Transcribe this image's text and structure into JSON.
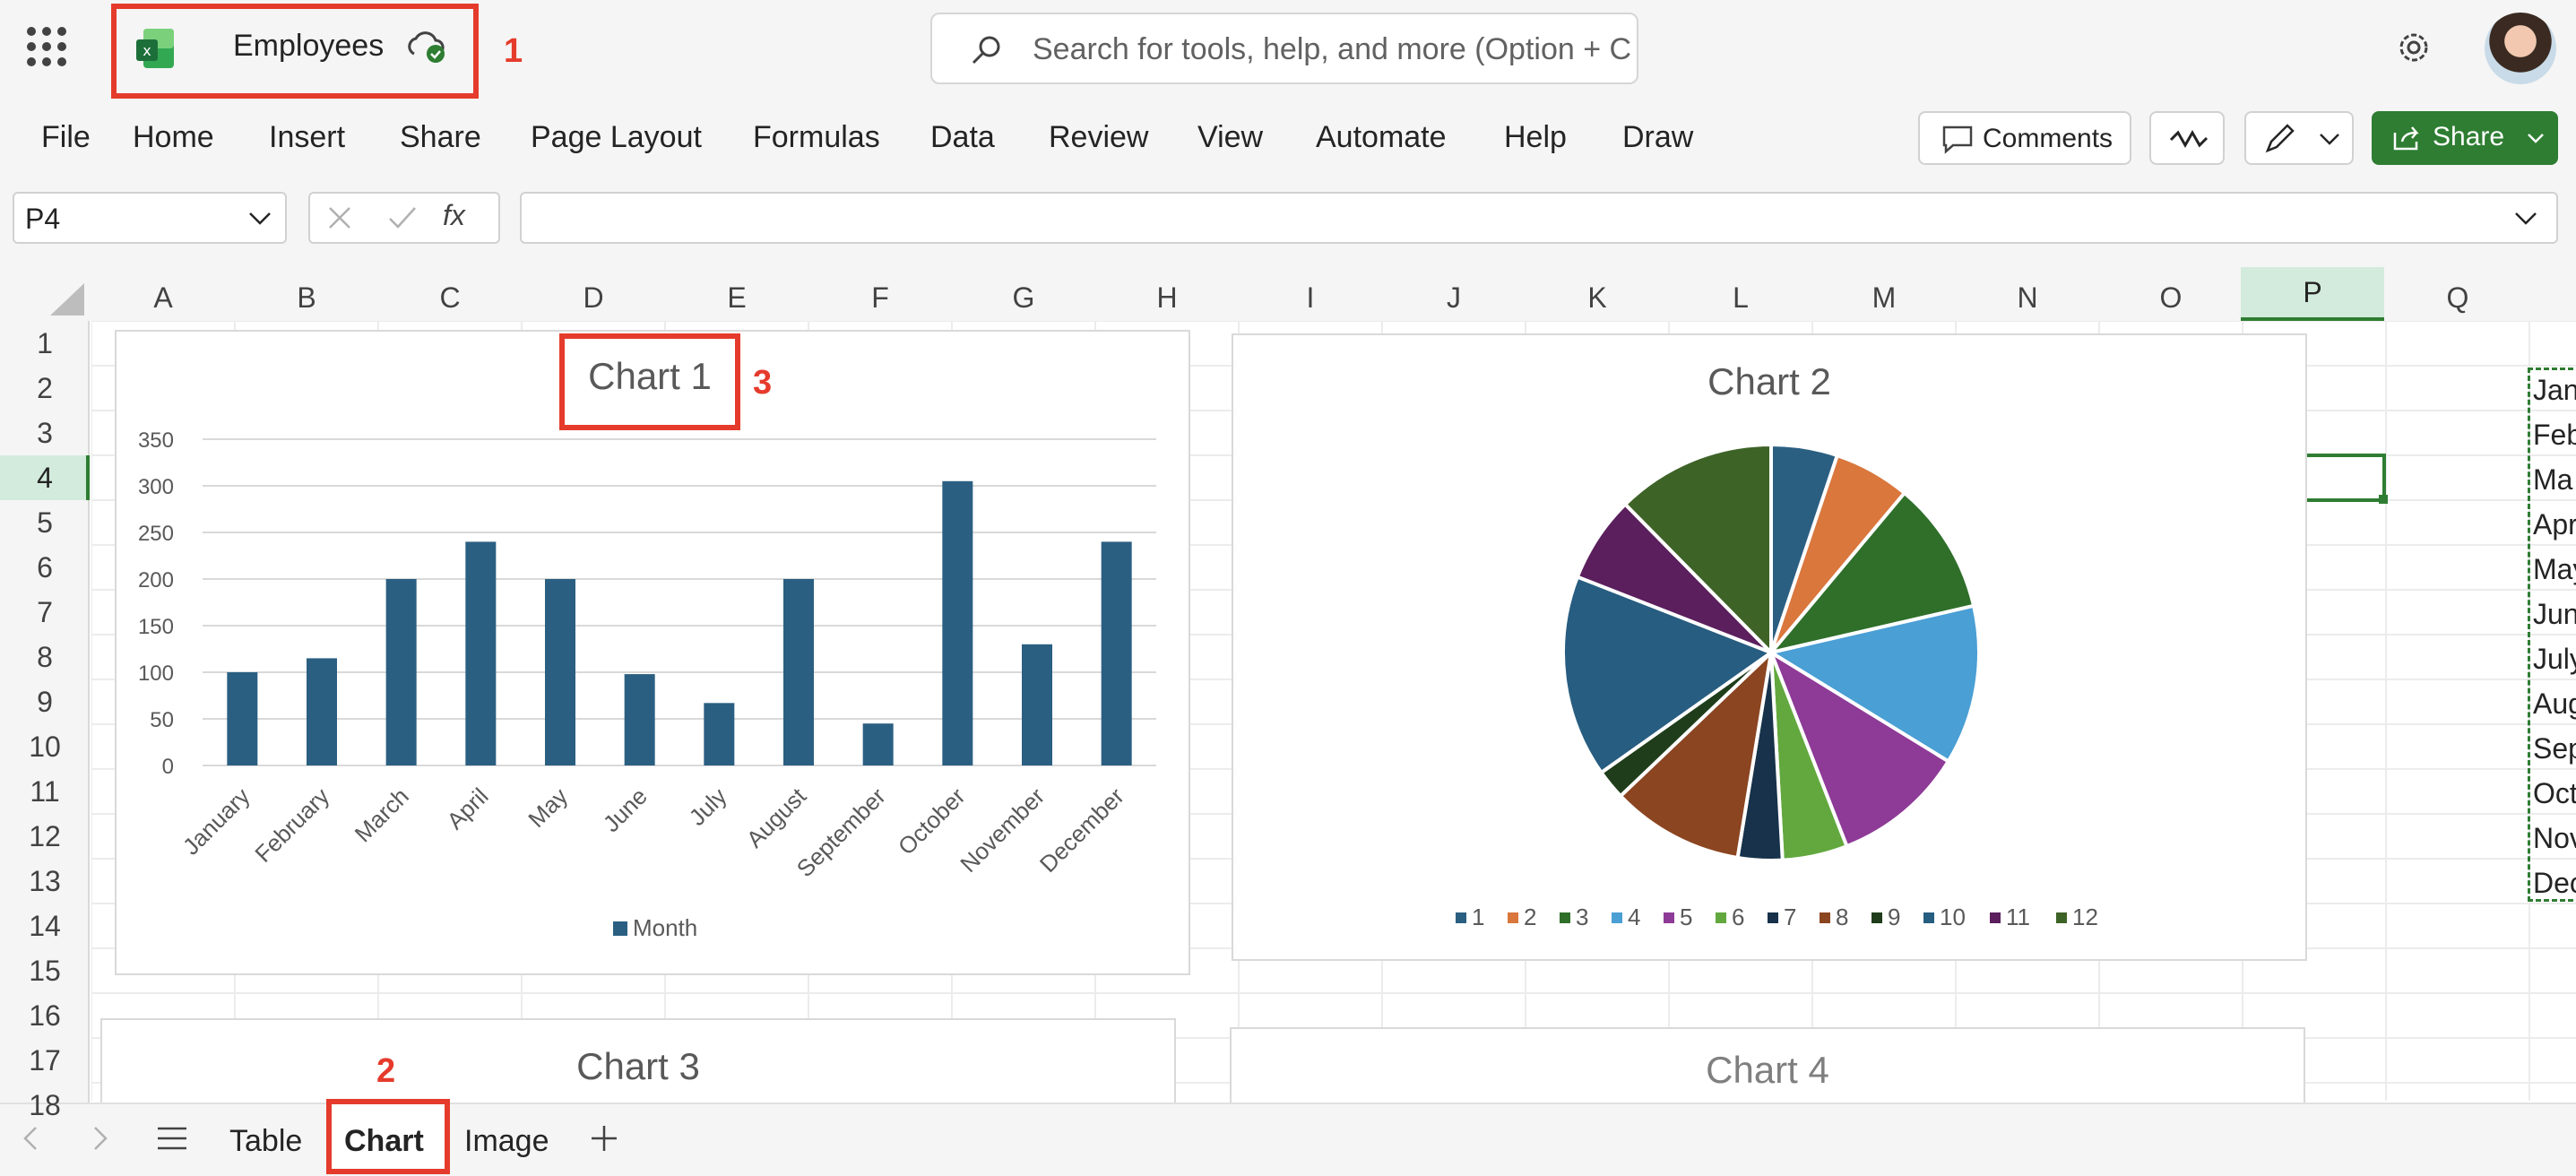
{
  "app": {
    "document_title": "Employees"
  },
  "annotations": {
    "one": "1",
    "two": "2",
    "three": "3"
  },
  "search": {
    "placeholder": "Search for tools, help, and more (Option + C"
  },
  "menu": [
    "File",
    "Home",
    "Insert",
    "Share",
    "Page Layout",
    "Formulas",
    "Data",
    "Review",
    "View",
    "Automate",
    "Help",
    "Draw"
  ],
  "toolbar": {
    "comments_label": "Comments",
    "share_label": "Share"
  },
  "formula_bar": {
    "name_box": "P4",
    "fx_label": "fx",
    "formula": ""
  },
  "columns": [
    "A",
    "B",
    "C",
    "D",
    "E",
    "F",
    "G",
    "H",
    "I",
    "J",
    "K",
    "L",
    "M",
    "N",
    "O",
    "P",
    "Q"
  ],
  "rows": [
    "1",
    "2",
    "3",
    "4",
    "5",
    "6",
    "7",
    "8",
    "9",
    "10",
    "11",
    "12",
    "13",
    "14",
    "15",
    "16",
    "17",
    "18"
  ],
  "selected_cell": {
    "column": "P",
    "row": "4"
  },
  "month_cells": [
    "Jan",
    "Feb",
    "Ma",
    "Apr",
    "May",
    "Jun",
    "July",
    "Aug",
    "Sep",
    "Oct",
    "Nov",
    "Dec"
  ],
  "chart_data": [
    {
      "type": "bar",
      "title": "Chart 1",
      "categories": [
        "January",
        "February",
        "March",
        "April",
        "May",
        "June",
        "July",
        "August",
        "September",
        "October",
        "November",
        "December"
      ],
      "series": [
        {
          "name": "Month",
          "values": [
            100,
            115,
            200,
            240,
            200,
            98,
            67,
            200,
            45,
            305,
            130,
            240
          ],
          "color": "#2b5f82"
        }
      ],
      "y_ticks": [
        "350",
        "300",
        "250",
        "200",
        "150",
        "100",
        "50",
        "0"
      ],
      "ylim": [
        0,
        350
      ],
      "legend": "bottom"
    },
    {
      "type": "pie",
      "title": "Chart 2",
      "labels": [
        "1",
        "2",
        "3",
        "4",
        "5",
        "6",
        "7",
        "8",
        "9",
        "10",
        "11",
        "12"
      ],
      "values": [
        100,
        115,
        200,
        240,
        200,
        98,
        67,
        200,
        45,
        305,
        130,
        240
      ],
      "colors": [
        "#2b5f82",
        "#d9773d",
        "#2f6f2a",
        "#4a9fd4",
        "#8e3a97",
        "#62a83e",
        "#17324a",
        "#8b4521",
        "#1f3d1a",
        "#275d80",
        "#5a1f5c",
        "#3e6327"
      ],
      "legend": "bottom"
    },
    {
      "type": "bar",
      "title": "Chart 3"
    },
    {
      "type": "bar",
      "title": "Chart 4"
    }
  ],
  "sheet_tabs": {
    "table": "Table",
    "chart": "Chart",
    "image": "Image",
    "active": "Chart"
  },
  "colors": {
    "accent_green": "#2e7d32",
    "annotation_red": "#e53b2c"
  }
}
